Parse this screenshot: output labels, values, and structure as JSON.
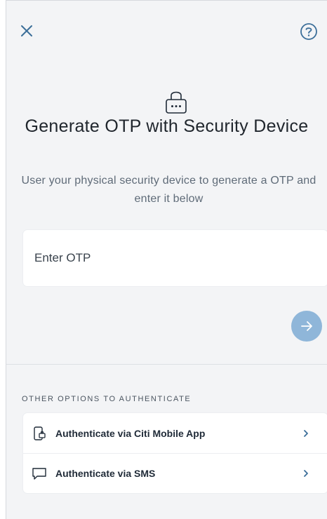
{
  "header": {
    "close_icon": "close-icon",
    "help_icon": "help-icon"
  },
  "main": {
    "icon": "lock-icon",
    "title": "Generate OTP with Security Device",
    "subtitle": "User your physical security device to generate a OTP and enter it below",
    "otp_input": {
      "placeholder": "Enter OTP",
      "value": ""
    },
    "submit_icon": "arrow-right-icon"
  },
  "options": {
    "heading": "OTHER OPTIONS TO AUTHENTICATE",
    "items": [
      {
        "label": "Authenticate via Citi Mobile App",
        "icon": "mobile-app-icon"
      },
      {
        "label": "Authenticate via SMS",
        "icon": "sms-icon"
      }
    ]
  },
  "colors": {
    "background": "#f3f4f6",
    "accent_disabled": "#8fb6d9",
    "icon": "#3b6e99"
  }
}
